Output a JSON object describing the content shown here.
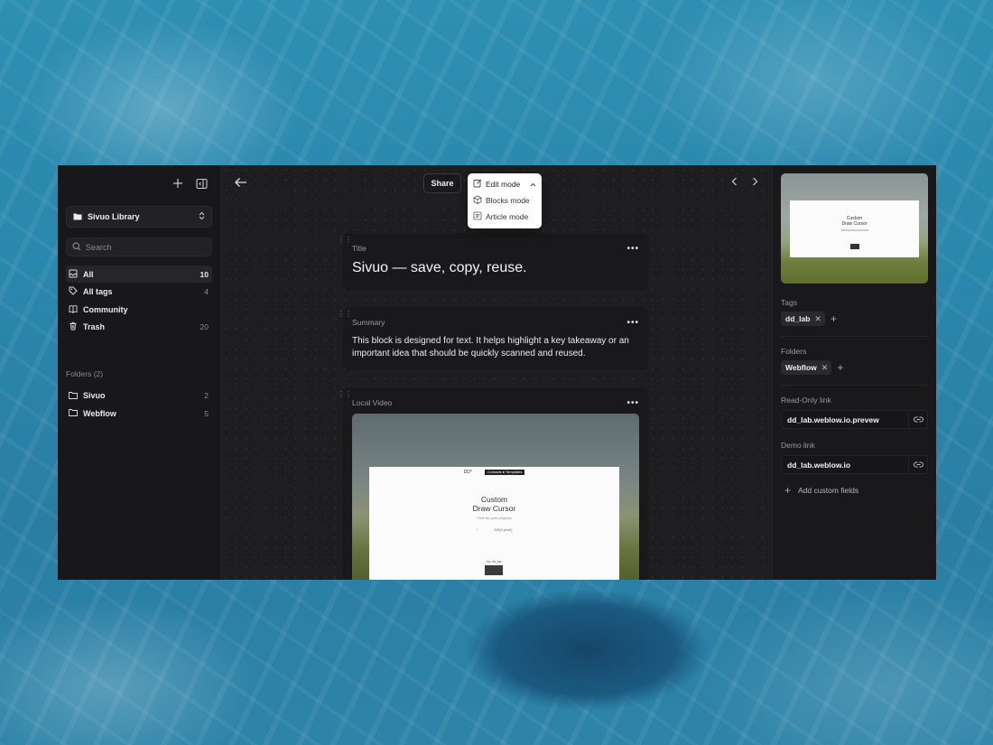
{
  "sidebar": {
    "library": "Sivuo Library",
    "search_placeholder": "Search",
    "nav": [
      {
        "label": "All",
        "count": "10",
        "icon": "inbox-icon"
      },
      {
        "label": "All tags",
        "count": "4",
        "icon": "tag-icon"
      },
      {
        "label": "Community",
        "count": "",
        "icon": "book-icon"
      },
      {
        "label": "Trash",
        "count": "20",
        "icon": "trash-icon"
      }
    ],
    "folders_heading": "Folders (2)",
    "folders": [
      {
        "label": "Sivuo",
        "count": "2"
      },
      {
        "label": "Webflow",
        "count": "5"
      }
    ]
  },
  "topbar": {
    "share": "Share",
    "modes": [
      "Edit mode",
      "Blocks mode",
      "Article mode"
    ]
  },
  "blocks": {
    "title": {
      "label": "Title",
      "text": "Sivuo — save, copy, reuse."
    },
    "summary": {
      "label": "Summary",
      "text": "This block is designed for text. It helps highlight a key takeaway or an important idea that should be quickly scanned and reused."
    },
    "video": {
      "label": "Local Video",
      "page_title_1": "Custom",
      "page_title_2": "Draw Cursor",
      "page_logo": "DD*",
      "page_pill": "Contacts ● Templates",
      "page_sub": "Free for your projects",
      "page_left": "↑",
      "page_right": "DD(0.pixel)",
      "page_foot": "by: dd_lab"
    }
  },
  "panel": {
    "preview_title_1": "Custom",
    "preview_title_2": "Draw Cursor",
    "tags_label": "Tags",
    "tags": [
      "dd_lab"
    ],
    "folders_label": "Folders",
    "folders": [
      "Webflow"
    ],
    "readonly_label": "Read-Only link",
    "readonly_value": "dd_lab.weblow.io.prevew",
    "demo_label": "Demo link",
    "demo_value": "dd_lab.weblow.io",
    "add_custom": "Add custom fields"
  }
}
